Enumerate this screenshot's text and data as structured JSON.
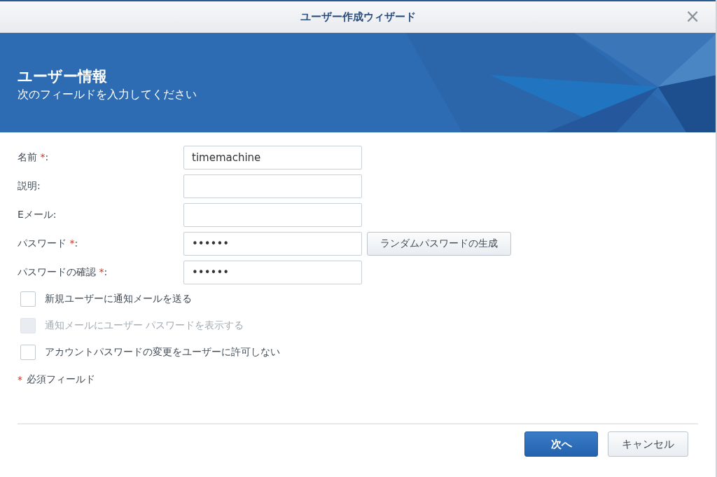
{
  "window": {
    "title": "ユーザー作成ウィザード",
    "close": "×"
  },
  "header": {
    "title": "ユーザー情報",
    "subtitle": "次のフィールドを入力してください"
  },
  "fields": [
    {
      "label": "名前",
      "mark": "*",
      "suffix": ":",
      "value": "timemachine"
    },
    {
      "label": "説明:"
    },
    {
      "label": "Eメール:"
    },
    {
      "label": "パスワード",
      "mark": "*",
      "suffix": ":",
      "value": "••••••",
      "button": "ランダムパスワードの生成"
    },
    {
      "label": "パスワードの確認",
      "mark": "*",
      "suffix": ":",
      "value": "••••••"
    }
  ],
  "options": [
    {
      "label": "新規ユーザーに通知メールを送る",
      "checked": false,
      "disabled": false
    },
    {
      "label": "通知メールにユーザー パスワードを表示する",
      "checked": false,
      "disabled": true
    },
    {
      "label": "アカウントパスワードの変更をユーザーに許可しない",
      "checked": false,
      "disabled": false
    }
  ],
  "required_note": {
    "mark": "*",
    "text": "必須フィールド"
  },
  "buttons": [
    {
      "label": "次へ",
      "kind": "primary"
    },
    {
      "label": "キャンセル",
      "kind": "secondary"
    }
  ]
}
